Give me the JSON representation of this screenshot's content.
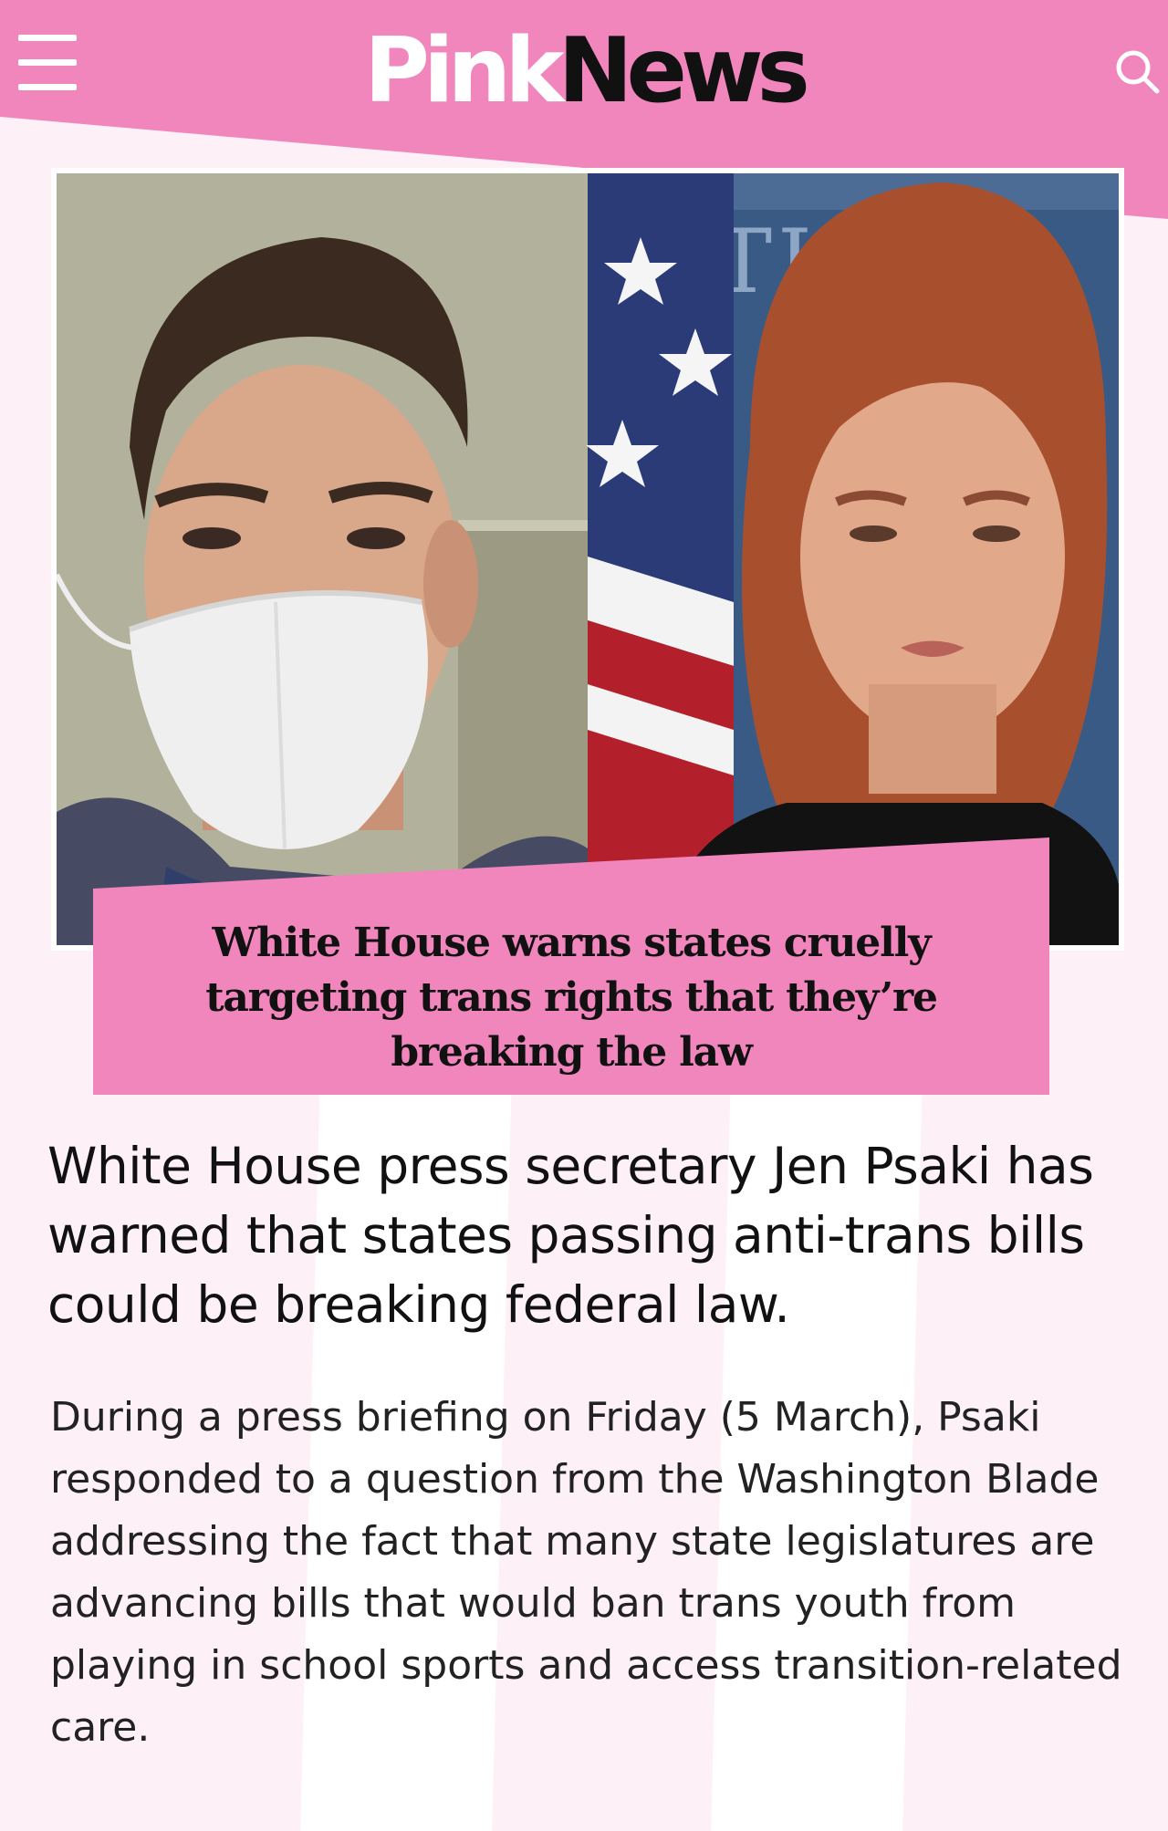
{
  "site": {
    "logo_part1": "Pink",
    "logo_part2": "News",
    "menu_icon": "hamburger-menu-icon",
    "search_icon": "search-icon"
  },
  "colors": {
    "brand_pink": "#f086bc",
    "background": "#fdf0f6",
    "text": "#111111"
  },
  "article": {
    "headline": "White House warns states cruelly targeting trans rights that they’re breaking the law",
    "standfirst": "White House press secretary Jen Psaki has warned that states passing anti-trans bills could be breaking federal law.",
    "body": "During a press briefing on Friday (5 March), Psaki responded to a question from the Washington Blade addressing the fact that many state legislatures are advancing bills that would ban trans youth from playing in school sports and access transition-related care."
  }
}
